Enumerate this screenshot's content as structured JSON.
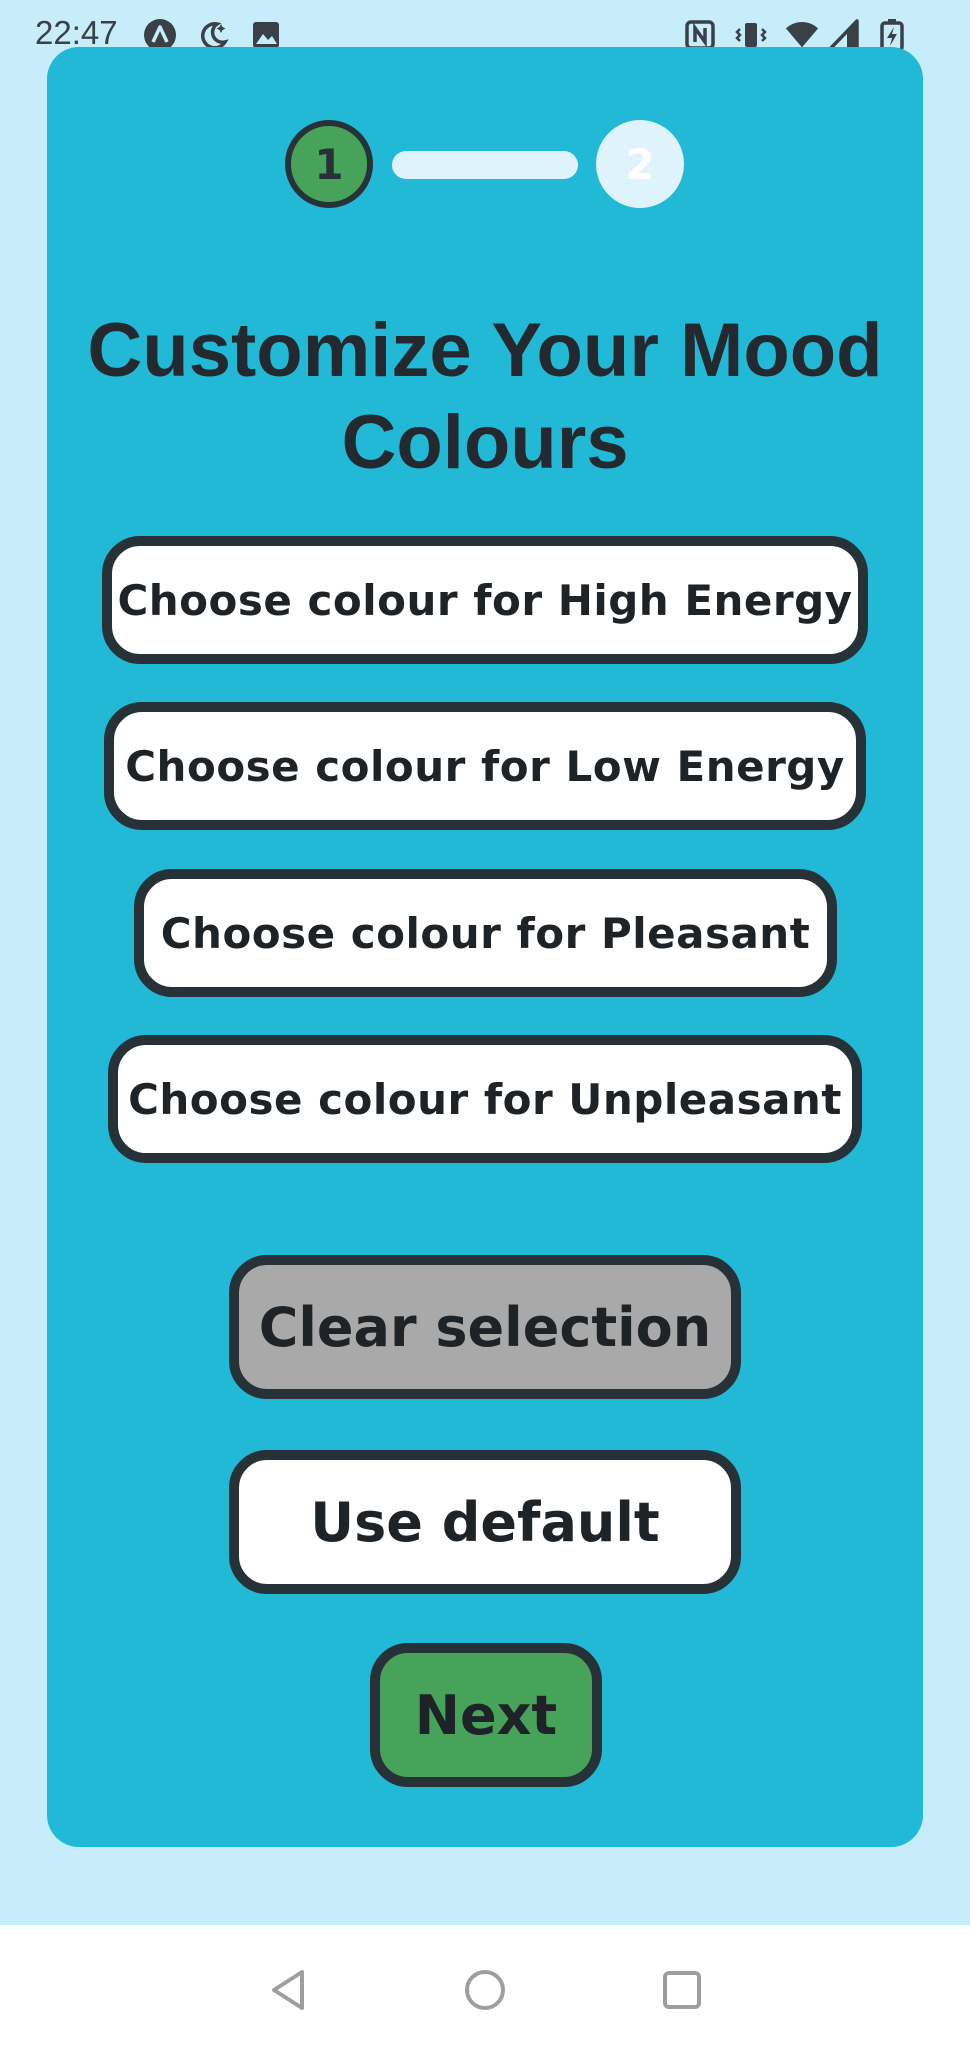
{
  "status_bar": {
    "time": "22:47",
    "icons": [
      "app-a-icon",
      "moon-star-icon",
      "image-icon",
      "nfc-icon",
      "vibrate-icon",
      "wifi-icon",
      "signal-icon",
      "battery-charging-icon"
    ]
  },
  "stepper": {
    "step1": "1",
    "step2": "2",
    "active_step": 1,
    "active_color": "#48a35a"
  },
  "title": "Customize Your Mood Colours",
  "mood_buttons": [
    {
      "label": "Choose colour for High Energy"
    },
    {
      "label": "Choose colour for Low Energy"
    },
    {
      "label": "Choose colour for Pleasant"
    },
    {
      "label": "Choose colour for Unpleasant"
    }
  ],
  "actions": {
    "clear": "Clear selection",
    "default": "Use default",
    "next": "Next"
  },
  "colors": {
    "page_background": "#c7edfb",
    "card_background": "#22b9d6",
    "clear_button": "#a9a9a9",
    "next_button": "#48a35a",
    "outline": "#263238"
  },
  "nav_bar": {
    "icons": [
      "back-icon",
      "home-icon",
      "recents-icon"
    ]
  }
}
